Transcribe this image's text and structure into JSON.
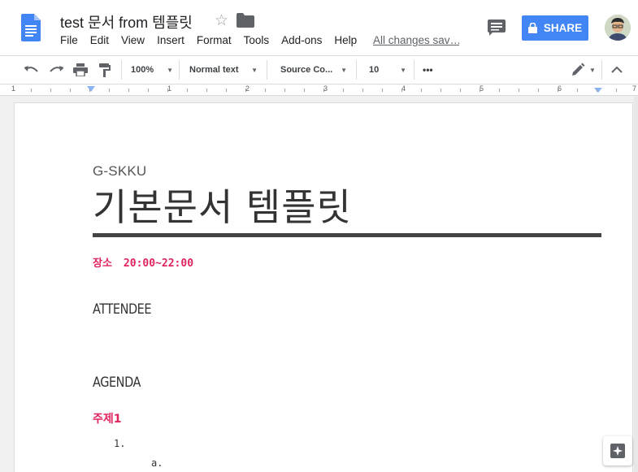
{
  "header": {
    "title": "test 문서 from 템플릿",
    "menu": [
      "File",
      "Edit",
      "View",
      "Insert",
      "Format",
      "Tools",
      "Add-ons",
      "Help"
    ],
    "save_status": "All changes sav…",
    "share_label": "SHARE"
  },
  "toolbar": {
    "zoom": "100%",
    "style": "Normal text",
    "font": "Source Co...",
    "size": "10",
    "more": "•••"
  },
  "ruler": {
    "numbers": [
      "1",
      "1",
      "2",
      "3",
      "4",
      "5",
      "6",
      "7"
    ]
  },
  "document": {
    "subtitle": "G-SKKU",
    "title": "기본문서 템플릿",
    "place_label": "장소",
    "place_time": "20:00~22:00",
    "attendee_heading": "ATTENDEE",
    "agenda_heading": "AGENDA",
    "topic": "주제1",
    "list_item_1": "1.",
    "list_item_2": "a."
  },
  "colors": {
    "accent": "#4285f4",
    "highlight": "#e0245e",
    "rule": "#444444"
  }
}
